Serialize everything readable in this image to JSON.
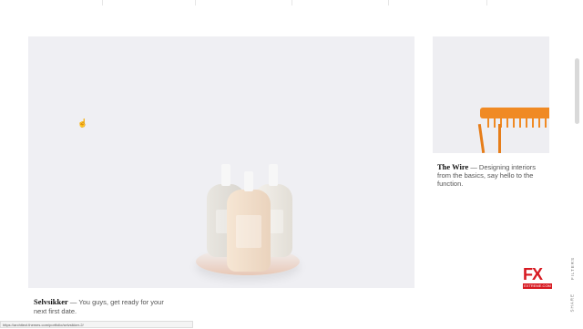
{
  "gallery": {
    "main_card": {
      "title": "Selvsikker",
      "caption": "— You guys, get ready for your next first date."
    },
    "side_card": {
      "title": "The Wire",
      "caption": "— Designing interiors from the basics, say hello to the function."
    }
  },
  "sidebar": {
    "filters_label": "FILTERS",
    "share_label": "SHARE"
  },
  "logo": {
    "primary": "FX",
    "secondary": "EXTREME.COM",
    "accent_color": "#d71921"
  },
  "status_bar": {
    "url": "https://architect.themes.com/portfolio/selvsikker-2/"
  },
  "colors": {
    "background": "#ffffff",
    "card": "#efeff3",
    "accent": "#f08a24"
  }
}
